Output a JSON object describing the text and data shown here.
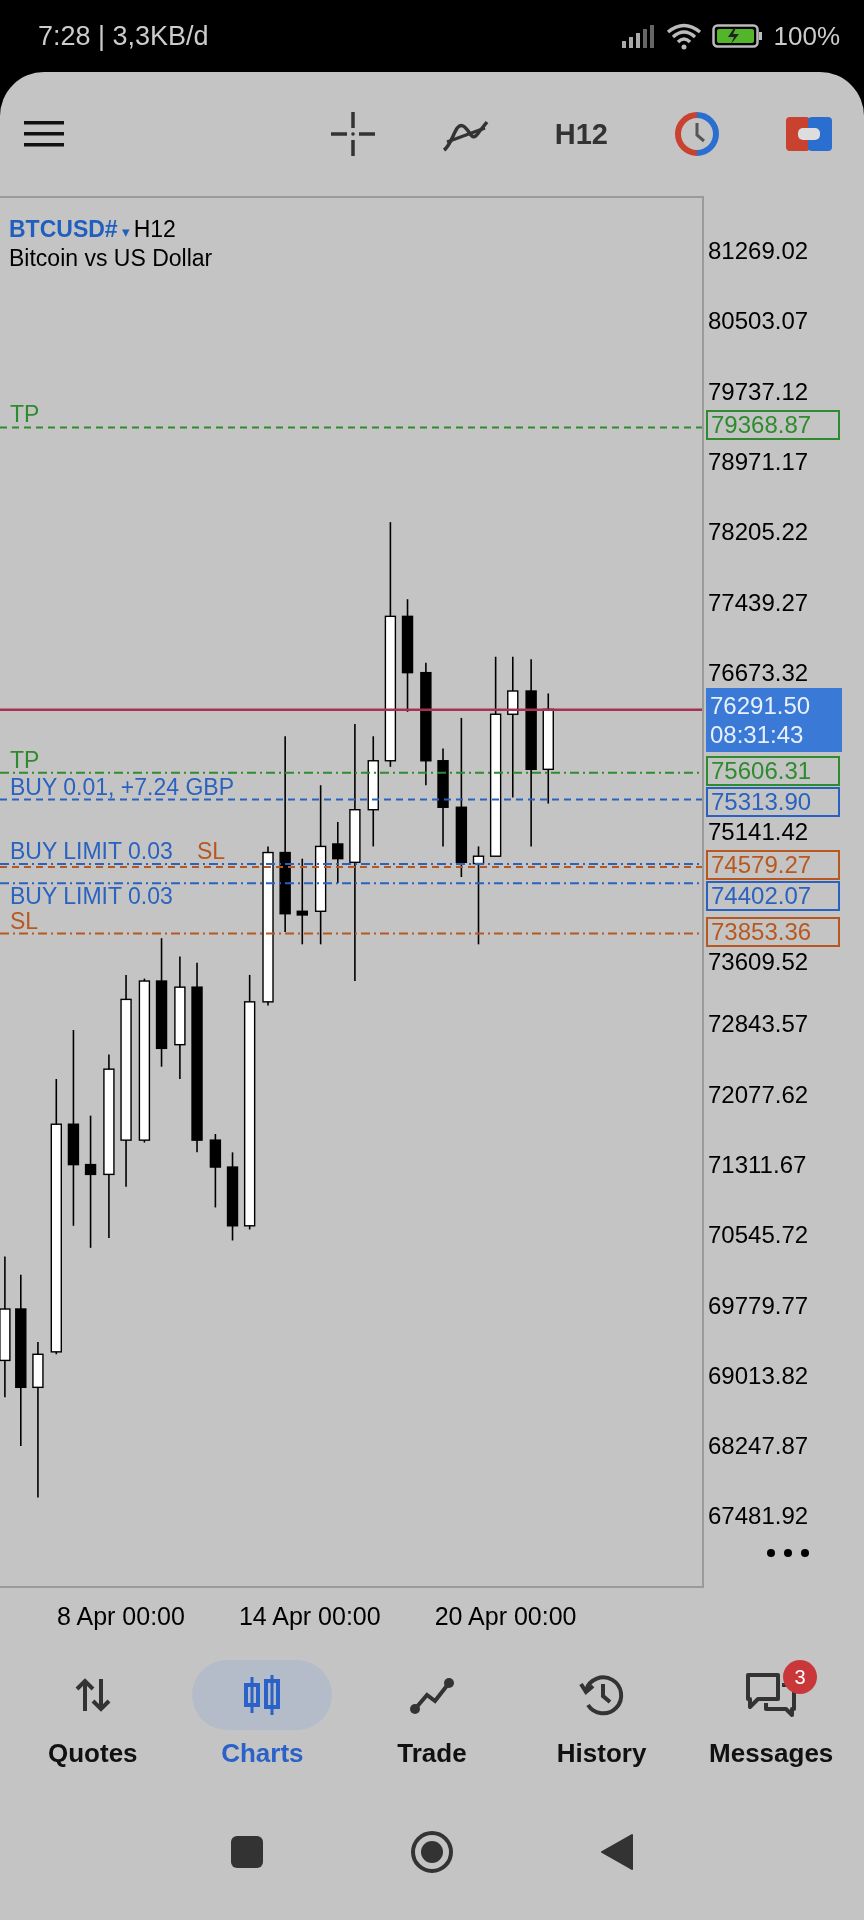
{
  "status_bar": {
    "time": "7:28 | 3,3KB/d",
    "battery": "100%"
  },
  "toolbar": {
    "timeframe": "H12"
  },
  "chart": {
    "symbol": "BTCUSD#",
    "symbol_caret": "▾",
    "timeframe": "H12",
    "description": "Bitcoin vs US Dollar",
    "price_scale": [
      "81269.02",
      "80503.07",
      "79737.12",
      "78971.17",
      "78205.22",
      "77439.27",
      "76673.32",
      "75141.42",
      "73609.52",
      "72843.57",
      "72077.62",
      "71311.67",
      "70545.72",
      "69779.77",
      "69013.82",
      "68247.87",
      "67481.92"
    ],
    "current_price": {
      "price": "76291.50",
      "time": "08:31:43"
    },
    "orders": [
      {
        "label": "TP",
        "price": "79368.87",
        "color": "#2e8b2e",
        "kind": "dashed"
      },
      {
        "label": "TP",
        "price": "75606.31",
        "color": "#2e8b2e",
        "kind": "dashdot"
      },
      {
        "label": "BUY 0.01,  +7.24 GBP",
        "price": "75313.90",
        "color": "#2a62c0",
        "kind": "dashed"
      },
      {
        "label": "BUY LIMIT 0.03",
        "color": "#2a62c0",
        "kind": "dashdot"
      },
      {
        "label": "SL",
        "price": "74579.27",
        "color": "#b8581f",
        "kind": "dashed"
      },
      {
        "label": "BUY LIMIT 0.03",
        "price": "74402.07",
        "color": "#2a62c0",
        "kind": "dashdot"
      },
      {
        "label": "SL",
        "price": "73853.36",
        "color": "#b8581f",
        "kind": "dashdot"
      }
    ],
    "time_scale": [
      "8 Apr 00:00",
      "14 Apr 00:00",
      "20 Apr 00:00"
    ]
  },
  "nav": [
    {
      "label": "Quotes",
      "kind": "quotes",
      "selected": false
    },
    {
      "label": "Charts",
      "kind": "charts",
      "selected": true
    },
    {
      "label": "Trade",
      "kind": "trade",
      "selected": false
    },
    {
      "label": "History",
      "kind": "history",
      "selected": false
    },
    {
      "label": "Messages",
      "kind": "messages",
      "selected": false,
      "badge": "3"
    }
  ]
}
